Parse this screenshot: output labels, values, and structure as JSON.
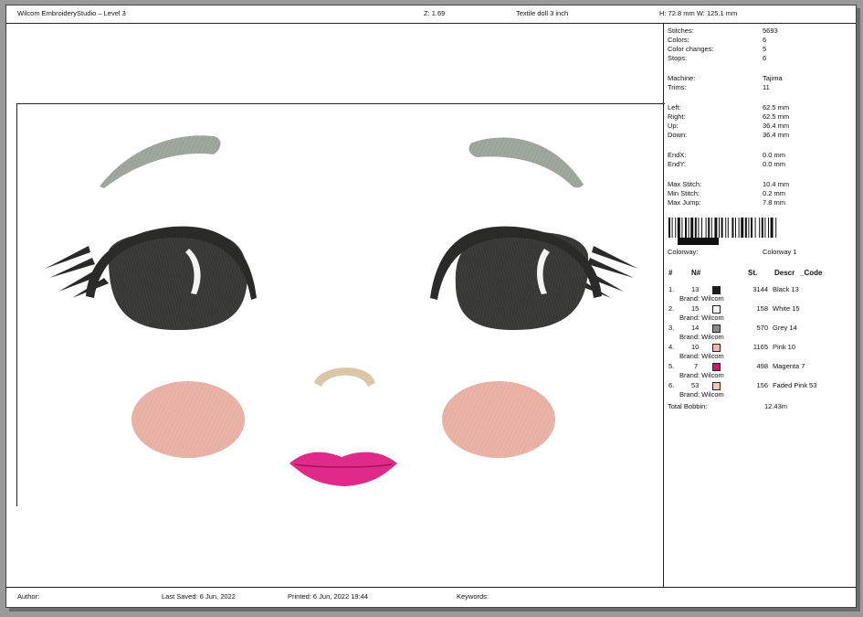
{
  "header": {
    "app_title": "Wilcom EmbroideryStudio – Level 3",
    "zoom": "Z: 1.69",
    "design_name": "Textile doll 3 inch",
    "size": "H: 72.8 mm  W: 125.1 mm"
  },
  "stats": [
    {
      "label": "Stitches:",
      "value": "5693"
    },
    {
      "label": "Colors:",
      "value": "6"
    },
    {
      "label": "Color changes:",
      "value": "5"
    },
    {
      "label": "Stops:",
      "value": "6"
    },
    {
      "label": "Machine:",
      "value": "Tajima"
    },
    {
      "label": "Trims:",
      "value": "11"
    },
    {
      "label": "Left:",
      "value": "62.5 mm"
    },
    {
      "label": "Right:",
      "value": "62.5 mm"
    },
    {
      "label": "Up:",
      "value": "36.4 mm"
    },
    {
      "label": "Down:",
      "value": "36.4 mm"
    },
    {
      "label": "EndX:",
      "value": "0.0 mm"
    },
    {
      "label": "EndY:",
      "value": "0.0 mm"
    },
    {
      "label": "Max Stitch:",
      "value": "10.4 mm"
    },
    {
      "label": "Min Stitch:",
      "value": "0.2 mm"
    },
    {
      "label": "Max Jump:",
      "value": "7.8 mm"
    }
  ],
  "colorway": {
    "label": "Colorway:",
    "value": "Colorway 1"
  },
  "color_table": {
    "headers": [
      "#",
      "N#",
      "St.",
      "Descr",
      "_Code"
    ],
    "rows": [
      {
        "idx": "1.",
        "n": "13",
        "color": "#1c1c1c",
        "st": "3144",
        "descr": "Black 13",
        "brand": "Brand: Wilcom"
      },
      {
        "idx": "2.",
        "n": "15",
        "color": "#ffffff",
        "st": "158",
        "descr": "White 15",
        "brand": "Brand: Wilcom"
      },
      {
        "idx": "3.",
        "n": "14",
        "color": "#8a8a8a",
        "st": "570",
        "descr": "Grey 14",
        "brand": "Brand: Wilcom"
      },
      {
        "idx": "4.",
        "n": "10",
        "color": "#f0b8ac",
        "st": "1165",
        "descr": "Pink 10",
        "brand": "Brand: Wilcom"
      },
      {
        "idx": "5.",
        "n": "7",
        "color": "#c7196e",
        "st": "498",
        "descr": "Magenta 7",
        "brand": "Brand: Wilcom"
      },
      {
        "idx": "6.",
        "n": "53",
        "color": "#f3c9bd",
        "st": "156",
        "descr": "Faded Pink 53",
        "brand": "Brand: Wilcom"
      }
    ],
    "total_label": "Total Bobbin:",
    "total_value": "12.43m"
  },
  "footer": {
    "author": "Author:",
    "last_saved": "Last Saved:  6 Jun, 2022",
    "printed": "Printed:  6 Jun, 2022 19:44",
    "keywords": "Keywords:"
  },
  "colors": {
    "eyebrow": "#9aa49a",
    "eye": "#3c3c3a",
    "eye_outline": "#2a2a28",
    "highlight": "#f4f4f0",
    "cheek": "#e8b0a4",
    "nose": "#dcc6a8",
    "lips": "#e02a8a"
  }
}
